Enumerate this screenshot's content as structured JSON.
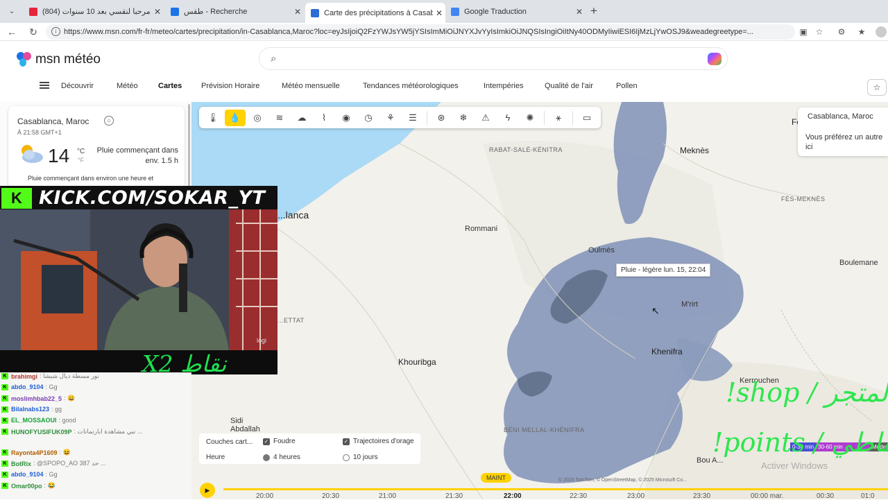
{
  "tabs": [
    {
      "title": "(804) مرحبا لنقسي بعد 10 سنوات - ...",
      "favicon_color": "#e8243b"
    },
    {
      "title": "طقس - Recherche",
      "favicon_color": "#1a73e8"
    },
    {
      "title": "Carte des précipitations à Casablanca...",
      "favicon_color": "#2d6cd6",
      "active": true
    },
    {
      "title": "Google Traduction",
      "favicon_color": "#4285f4"
    }
  ],
  "address": {
    "url": "https://www.msn.com/fr-fr/meteo/cartes/precipitation/in-Casablanca,Maroc?loc=eyJsIjoiQ2FzYWJsYW5jYSIsImMiOiJNYXJvYyIsImkiOiJNQSIsIngiOiItNy40ODMyIiwiESI6IjMzLjYwOSJ9&weadegreetype=..."
  },
  "msn": {
    "logo_text": "msn météo",
    "nav": [
      "Découvrir",
      "Météo",
      "Cartes",
      "Prévision Horaire",
      "Météo mensuelle",
      "Tendances météorologiques",
      "Intempéries",
      "Qualité de l'air",
      "Pollen"
    ],
    "active_nav": "Cartes"
  },
  "weather_card": {
    "location": "Casablanca, Maroc",
    "time": "À 21:58 GMT+1",
    "temperature": "14",
    "unit_c": "°C",
    "unit_f": "°F",
    "condition": "Pluie commençant dans env. 1.5 h",
    "summary": "Pluie commençant dans environ une heure et"
  },
  "map": {
    "cities": [
      {
        "name": "Meknès",
        "cls": "big"
      },
      {
        "name": "Fès",
        "cls": "big"
      },
      {
        "name": "Rommani",
        "cls": ""
      },
      {
        "name": "Oulmès",
        "cls": ""
      },
      {
        "name": "Boulemane",
        "cls": ""
      },
      {
        "name": "M'rirt",
        "cls": ""
      },
      {
        "name": "Khenifra",
        "cls": "big"
      },
      {
        "name": "Khouribga",
        "cls": "big"
      },
      {
        "name": "Kerrouchen",
        "cls": ""
      },
      {
        "name": "Bou A...",
        "cls": ""
      },
      {
        "name": "Sidi Abdallah",
        "cls": ""
      },
      {
        "name": "...lanca",
        "cls": "big"
      }
    ],
    "regions": [
      "RABAT-SALÉ-KÉNITRA",
      "FÈS-MEKNÈS",
      "BÉNI MELLAL-KHÉNIFRA",
      "...ETTAT"
    ],
    "tooltip": "Pluie - légère lun. 15, 22:04",
    "info_card": {
      "title": "Casablanca, Maroc",
      "text": "Vous préférez un autre ici"
    },
    "layers": {
      "title": "Couches cart...",
      "foudre": "Foudre",
      "trajectoires": "Trajectoires d'orage",
      "heure": "Heure",
      "option1": "4 heures",
      "option2": "10 jours"
    },
    "timeline": {
      "now": "MAINT",
      "ticks": [
        "20:00",
        "20:30",
        "21:00",
        "21:30",
        "22:00",
        "22:30",
        "23:00",
        "23:30",
        "00:00 mar.",
        "00:30",
        "01:0"
      ]
    },
    "legend": [
      "0-30 min",
      "30-60 min",
      "Mode"
    ],
    "copyright": "© 2025 TomTom, © OpenStreetMap, © 2025 Microsoft Co...",
    "rain_color": "#8b9bbd"
  },
  "stream": {
    "kick_url": "KICK.COM/SOKAR_YT",
    "points_banner": "X2 نقاط",
    "shop_overlay": "!shop / المتجر",
    "points_overlay": "!points / نقاطي",
    "activate": "Activer Windows",
    "chat": [
      {
        "user": "brahimgi",
        "msg": ": نور مسطة ديال شيشا",
        "color": "#b0342f"
      },
      {
        "user": "abdo_9104",
        "msg": ": Gg",
        "color": "#1e5ed6"
      },
      {
        "user": "moslimhbab22_5",
        "msg": ": 😄",
        "color": "#7a3fb5"
      },
      {
        "user": "Bilalnabs123",
        "msg": ": gg",
        "color": "#1e5ed6"
      },
      {
        "user": "EL_MOSSAOUI",
        "msg": ": good",
        "color": "#12a23a"
      },
      {
        "user": "HUNOFYUSIFUK09P",
        "msg": ": نبي مشاهدة ابارتمانات ...",
        "color": "#2c8f3b"
      },
      {
        "user": "Rayonta4P1609",
        "msg": ": 😆",
        "color": "#b25f00"
      },
      {
        "user": "BotRix",
        "msg": ": @SPOPO_AO 387 حد ...",
        "color": "#2c8f3b"
      },
      {
        "user": "abdo_9104",
        "msg": ": Gg",
        "color": "#1e5ed6"
      },
      {
        "user": "Omar00po",
        "msg": ": 😂",
        "color": "#2c8f3b"
      }
    ]
  }
}
